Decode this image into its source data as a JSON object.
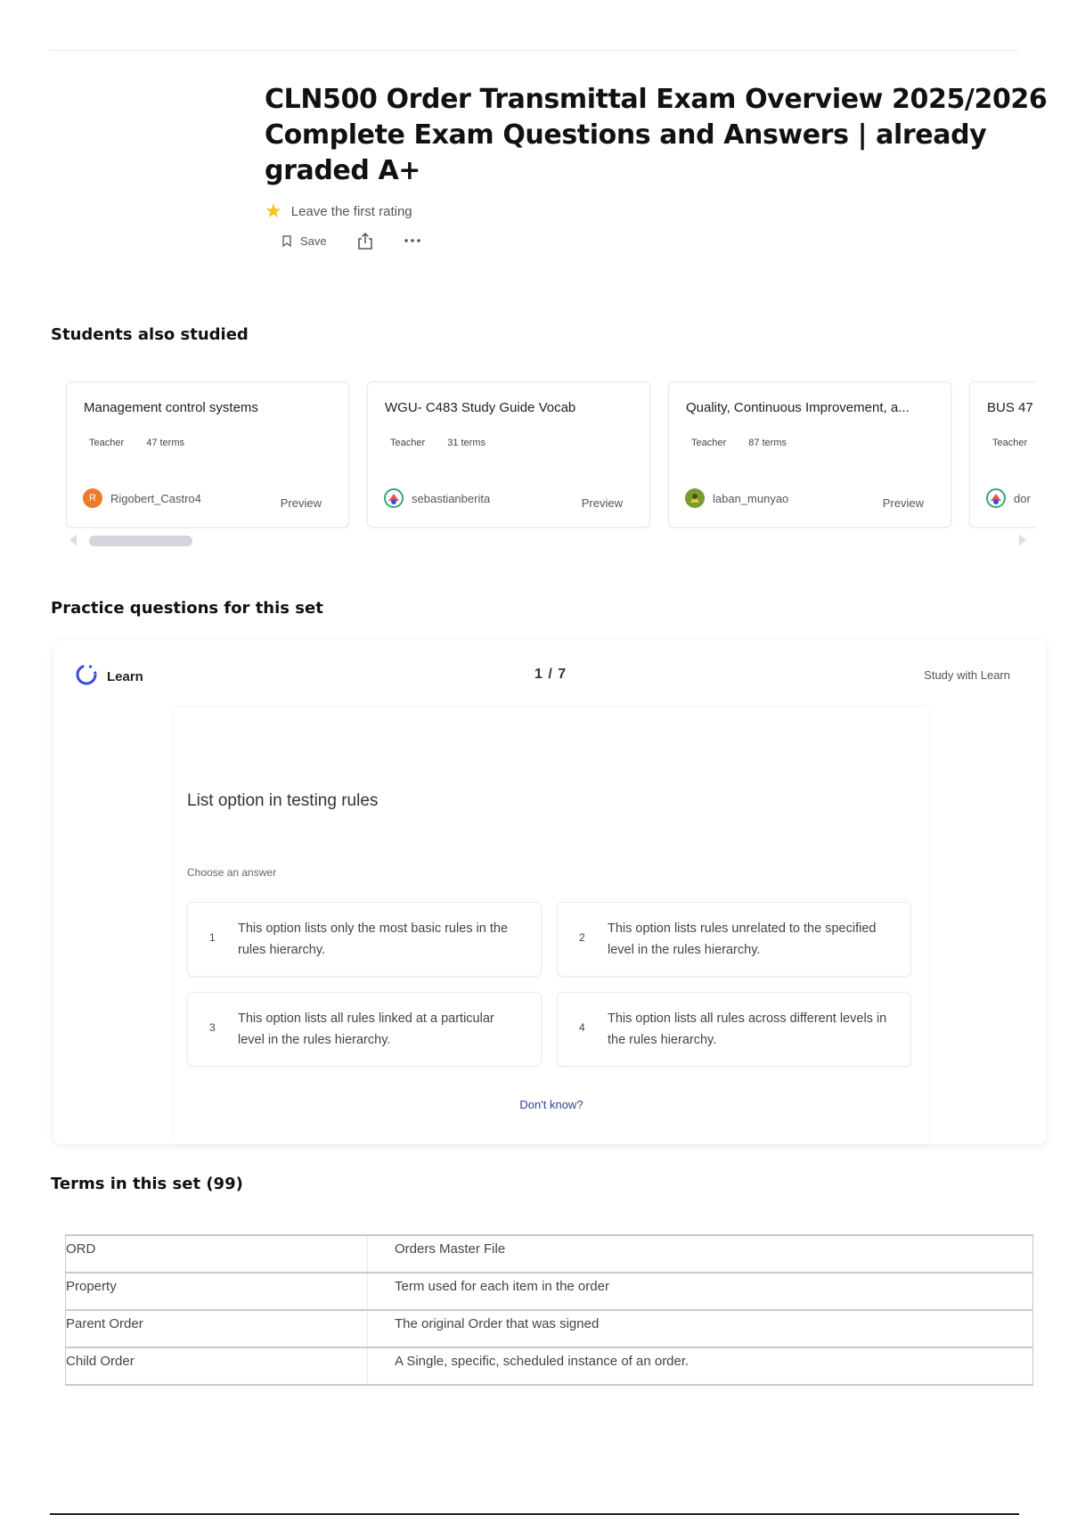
{
  "header": {
    "title": "CLN500 Order Transmittal Exam Overview 2025/2026 Complete Exam Questions and Answers | already graded A+",
    "rating_text": "Leave the first rating",
    "save_label": "Save"
  },
  "students_also_studied": {
    "title": "Students also studied",
    "cards": [
      {
        "title": "Management control systems",
        "role": "Teacher",
        "terms": "47 terms",
        "user": "Rigobert_Castro4",
        "avatar_letter": "R",
        "preview": "Preview"
      },
      {
        "title": "WGU- C483 Study Guide Vocab",
        "role": "Teacher",
        "terms": "31 terms",
        "user": "sebastianberita",
        "avatar_letter": "",
        "preview": "Preview"
      },
      {
        "title": "Quality, Continuous Improvement, a...",
        "role": "Teacher",
        "terms": "87 terms",
        "user": "laban_munyao",
        "avatar_letter": "",
        "preview": "Preview"
      },
      {
        "title": "BUS 47",
        "role": "Teacher",
        "terms": "",
        "user": "dor",
        "avatar_letter": "",
        "preview": ""
      }
    ]
  },
  "practice": {
    "title": "Practice questions for this set",
    "mode_label": "Learn",
    "counter": "1 / 7",
    "study_link": "Study with Learn",
    "question": "List option in testing rules",
    "choose_label": "Choose an answer",
    "options": [
      {
        "num": "1",
        "text": "This option lists only the most basic rules in the rules hierarchy."
      },
      {
        "num": "2",
        "text": "This option lists rules unrelated to the specified level in the rules hierarchy."
      },
      {
        "num": "3",
        "text": "This option lists all rules linked at a particular level in the rules hierarchy."
      },
      {
        "num": "4",
        "text": "This option lists all rules across different levels in the rules hierarchy."
      }
    ],
    "dont_know": "Don't know?"
  },
  "terms": {
    "title": "Terms in this set (99)",
    "rows": [
      {
        "term": "ORD",
        "definition": "Orders Master File"
      },
      {
        "term": "Property",
        "definition": "Term used for each item in the order"
      },
      {
        "term": "Parent Order",
        "definition": "The original Order that was signed"
      },
      {
        "term": "Child Order",
        "definition": "A Single, specific, scheduled instance of an order."
      }
    ]
  },
  "colors": {
    "star": "#f5c518",
    "learn_icon": "#3b4bd8",
    "dont_know_link": "#2f3f93",
    "avatar_orange": "#ee7b2a"
  }
}
